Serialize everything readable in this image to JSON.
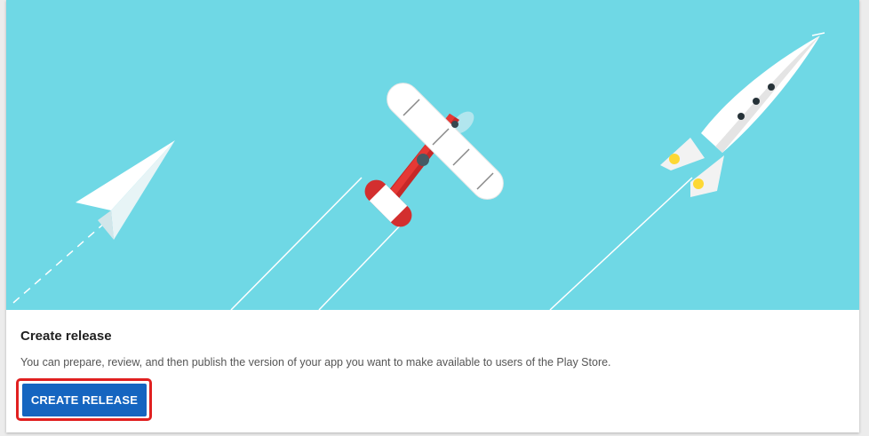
{
  "card": {
    "title": "Create release",
    "description": "You can prepare, review, and then publish the version of your app you want to make available to users of the Play Store.",
    "button_label": "CREATE RELEASE"
  },
  "illustration": {
    "background_color": "#6fd8e5",
    "objects": [
      "paper-plane-icon",
      "biplane-icon",
      "rocket-icon"
    ]
  },
  "colors": {
    "primary_button": "#1565c0",
    "highlight_border": "#e02020"
  }
}
